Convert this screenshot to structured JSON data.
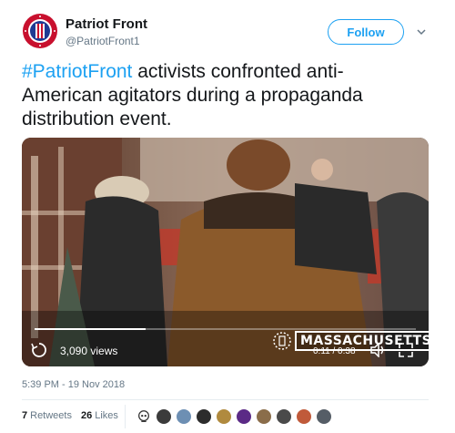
{
  "author": {
    "name": "Patriot Front",
    "handle": "@PatriotFront1",
    "avatar_colors": [
      "#c8102e",
      "#1f3a93",
      "#ffffff"
    ]
  },
  "follow_label": "Follow",
  "tweet": {
    "hashtag": "#PatriotFront",
    "text": " activists confronted anti-American agitators during a propaganda distribution event."
  },
  "video": {
    "views": "3,090 views",
    "time": "0:11 / 0:38",
    "watermark": "MASSACHUSETTS",
    "progress": 0.29
  },
  "timestamp": "5:39 PM - 19 Nov 2018",
  "stats": {
    "retweets_count": "7",
    "retweets_label": "Retweets",
    "likes_count": "26",
    "likes_label": "Likes"
  },
  "likers": [
    {
      "icon": "skull-icon",
      "color": "#ffffff"
    },
    {
      "icon": "avatar",
      "color": "#3b3b3b"
    },
    {
      "icon": "avatar",
      "color": "#6d8fb3"
    },
    {
      "icon": "avatar",
      "color": "#2c2c2c"
    },
    {
      "icon": "avatar",
      "color": "#b08a3e"
    },
    {
      "icon": "avatar",
      "color": "#5b2a86"
    },
    {
      "icon": "avatar",
      "color": "#8a6d4a"
    },
    {
      "icon": "avatar",
      "color": "#4a4a4a"
    },
    {
      "icon": "avatar",
      "color": "#c05a3a"
    },
    {
      "icon": "avatar",
      "color": "#555d66"
    }
  ],
  "colors": {
    "link": "#1da1f2",
    "muted": "#657786",
    "text": "#14171a"
  }
}
